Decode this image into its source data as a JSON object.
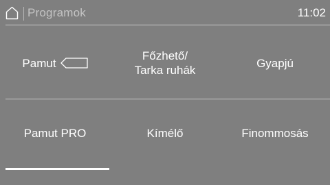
{
  "status_bar": {
    "breadcrumb": "Programok",
    "time": "11:02",
    "home_icon": "home-icon"
  },
  "programs": [
    {
      "label": "Pamut",
      "has_tag_icon": true
    },
    {
      "label": "Főzhető/\nTarka  ruhák",
      "has_tag_icon": false
    },
    {
      "label": "Gyapjú",
      "has_tag_icon": false
    },
    {
      "label": "Pamut PRO",
      "has_tag_icon": false
    },
    {
      "label": "Kímélő",
      "has_tag_icon": false
    },
    {
      "label": "Finommosás",
      "has_tag_icon": false
    }
  ],
  "page_indicator": {
    "progress": 0.32
  },
  "colors": {
    "background": "#7f7f7f",
    "text": "#ffffff",
    "muted_text": "#c4c4c4",
    "divider": "#c9c9c9"
  }
}
